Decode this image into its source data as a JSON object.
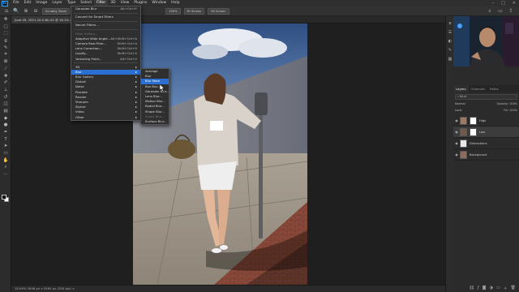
{
  "menubar": {
    "logo": "Ps",
    "items": [
      "File",
      "Edit",
      "Image",
      "Layer",
      "Type",
      "Select",
      "Filter",
      "3D",
      "View",
      "Plugins",
      "Window",
      "Help"
    ],
    "active_index": 6
  },
  "optionsbar": {
    "scrub_zoom": "Scrubby Zoom",
    "buttons": [
      "100%",
      "Fit Screen",
      "Fill Screen"
    ]
  },
  "document": {
    "tab_title": "June 09, 2021-10-0-60-02 @ 16.1% (Lines, RGB/8*) *"
  },
  "status": {
    "text": "16.09%    3648 px x 5464 px (300 ppi)    >"
  },
  "filter_menu": {
    "items": [
      {
        "label": "Gaussian Blur",
        "shortcut": "Alt+Ctrl+F"
      },
      {
        "sep": true
      },
      {
        "label": "Convert for Smart Filters"
      },
      {
        "sep": true
      },
      {
        "label": "Neural Filters..."
      },
      {
        "sep": true
      },
      {
        "label": "Filter Gallery...",
        "disabled": true
      },
      {
        "label": "Adaptive Wide Angle...",
        "shortcut": "Alt+Shift+Ctrl+A"
      },
      {
        "label": "Camera Raw Filter...",
        "shortcut": "Shift+Ctrl+A"
      },
      {
        "label": "Lens Correction...",
        "shortcut": "Shift+Ctrl+R"
      },
      {
        "label": "Liquify...",
        "shortcut": "Shift+Ctrl+X"
      },
      {
        "label": "Vanishing Point...",
        "shortcut": "Alt+Ctrl+V"
      },
      {
        "sep": true
      },
      {
        "label": "3D",
        "submenu": true
      },
      {
        "label": "Blur",
        "submenu": true,
        "highlighted": true
      },
      {
        "label": "Blur Gallery",
        "submenu": true
      },
      {
        "label": "Distort",
        "submenu": true
      },
      {
        "label": "Noise",
        "submenu": true
      },
      {
        "label": "Pixelate",
        "submenu": true
      },
      {
        "label": "Render",
        "submenu": true
      },
      {
        "label": "Sharpen",
        "submenu": true
      },
      {
        "label": "Stylize",
        "submenu": true
      },
      {
        "label": "Video",
        "submenu": true
      },
      {
        "label": "Other",
        "submenu": true
      }
    ]
  },
  "blur_submenu": {
    "items": [
      {
        "label": "Average"
      },
      {
        "label": "Blur"
      },
      {
        "label": "Blur More",
        "highlighted": true
      },
      {
        "label": "Box Blur..."
      },
      {
        "label": "Gaussian Blur..."
      },
      {
        "label": "Lens Blur..."
      },
      {
        "label": "Motion Blur..."
      },
      {
        "label": "Radial Blur..."
      },
      {
        "label": "Shape Blur..."
      },
      {
        "label": "Smart Blur...",
        "disabled": true
      },
      {
        "label": "Surface Blur..."
      }
    ]
  },
  "layers_panel": {
    "tabs": [
      "Layers",
      "Channels",
      "Paths"
    ],
    "filter_label": "Kind",
    "blend_mode": "Normal",
    "opacity_label": "Opacity:",
    "opacity_value": "100%",
    "lock_label": "Lock:",
    "fill_label": "Fill:",
    "fill_value": "100%",
    "layers": [
      {
        "name": "High",
        "selected": false,
        "thumb": "#9a7a66",
        "mask": true
      },
      {
        "name": "Low",
        "selected": true,
        "thumb": "#6f5a4e",
        "mask": true
      },
      {
        "name": "Distractions",
        "selected": false,
        "thumb": "#e8e8e8",
        "mask": false
      },
      {
        "name": "Background",
        "selected": false,
        "thumb": "#8a6d5c",
        "mask": false
      }
    ]
  }
}
